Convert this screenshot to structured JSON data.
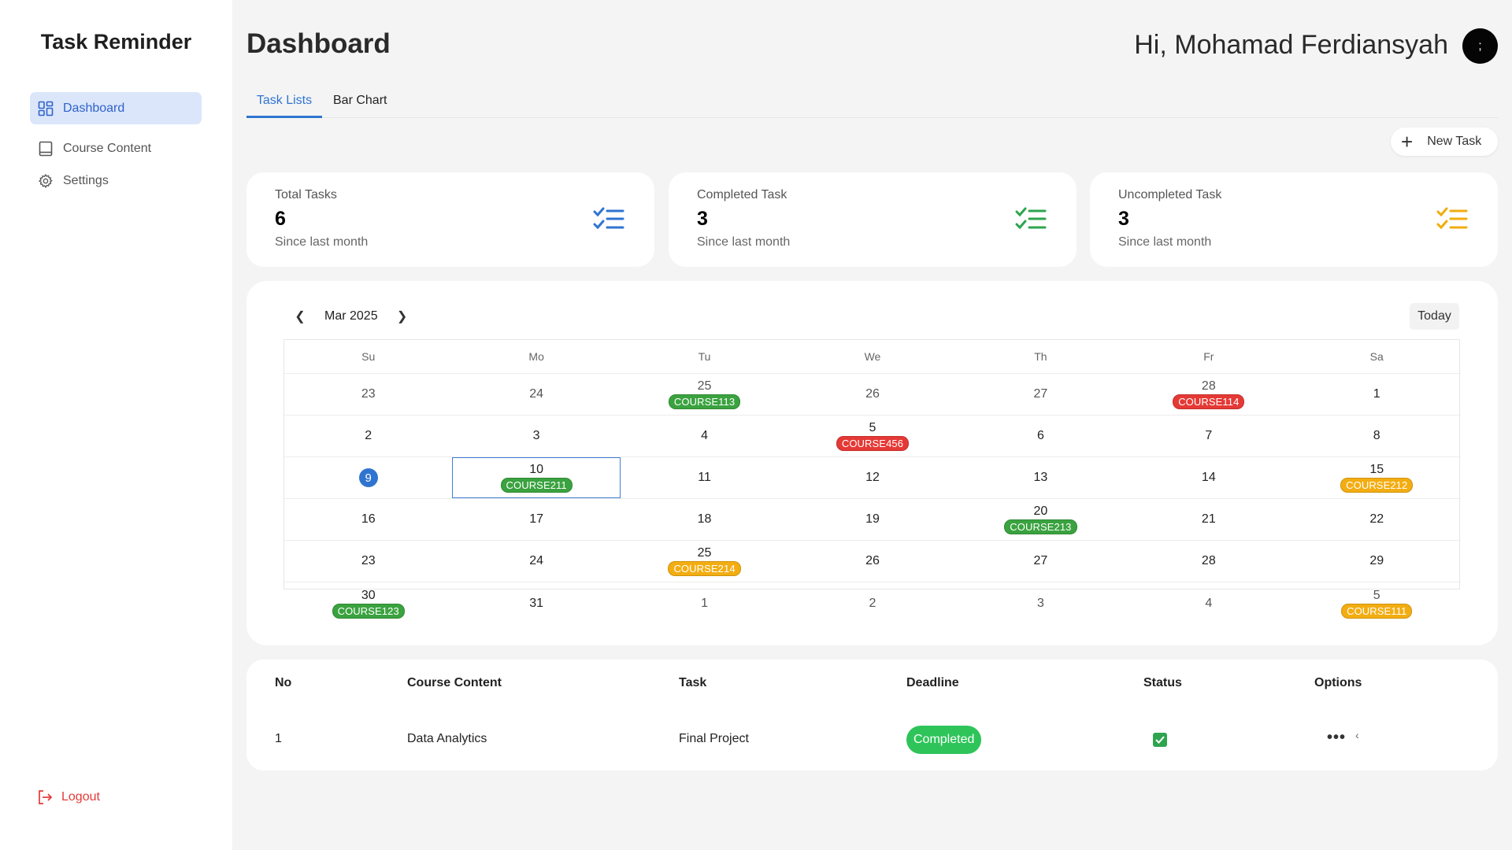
{
  "app": {
    "title": "Task Reminder"
  },
  "sidebar": {
    "items": [
      {
        "label": "Dashboard",
        "icon": "dashboard-icon"
      },
      {
        "label": "Course Content",
        "icon": "book-icon"
      },
      {
        "label": "Settings",
        "icon": "gear-icon"
      }
    ],
    "logout_label": "Logout"
  },
  "header": {
    "title": "Dashboard",
    "greeting": "Hi, Mohamad Ferdiansyah",
    "avatar_text": ";"
  },
  "tabs": [
    {
      "label": "Task Lists"
    },
    {
      "label": "Bar Chart"
    }
  ],
  "toolbar": {
    "new_task_label": "New Task"
  },
  "stats": [
    {
      "label": "Total Tasks",
      "value": "6",
      "sub": "Since last month",
      "color": "#2f74d0"
    },
    {
      "label": "Completed Task",
      "value": "3",
      "sub": "Since last month",
      "color": "#2ea44f"
    },
    {
      "label": "Uncompleted Task",
      "value": "3",
      "sub": "Since last month",
      "color": "#f0ad0e"
    }
  ],
  "calendar": {
    "month_label": "Mar 2025",
    "today_label": "Today",
    "weekdays": [
      "Su",
      "Mo",
      "Tu",
      "We",
      "Th",
      "Fr",
      "Sa"
    ],
    "badge_colors": {
      "green": "#3aa23f",
      "red": "#e53935",
      "yellow": "#f3ad12"
    },
    "weeks": [
      [
        {
          "d": "23",
          "o": true
        },
        {
          "d": "24",
          "o": true
        },
        {
          "d": "25",
          "o": true,
          "b": "COURSE113",
          "c": "green"
        },
        {
          "d": "26",
          "o": true
        },
        {
          "d": "27",
          "o": true
        },
        {
          "d": "28",
          "o": true,
          "b": "COURSE114",
          "c": "red"
        },
        {
          "d": "1"
        }
      ],
      [
        {
          "d": "2"
        },
        {
          "d": "3"
        },
        {
          "d": "4"
        },
        {
          "d": "5",
          "b": "COURSE456",
          "c": "red"
        },
        {
          "d": "6"
        },
        {
          "d": "7"
        },
        {
          "d": "8"
        }
      ],
      [
        {
          "d": "9",
          "today": true
        },
        {
          "d": "10",
          "b": "COURSE211",
          "c": "green",
          "sel": true
        },
        {
          "d": "11"
        },
        {
          "d": "12"
        },
        {
          "d": "13"
        },
        {
          "d": "14"
        },
        {
          "d": "15",
          "b": "COURSE212",
          "c": "yellow"
        }
      ],
      [
        {
          "d": "16"
        },
        {
          "d": "17"
        },
        {
          "d": "18"
        },
        {
          "d": "19"
        },
        {
          "d": "20",
          "b": "COURSE213",
          "c": "green"
        },
        {
          "d": "21"
        },
        {
          "d": "22"
        }
      ],
      [
        {
          "d": "23"
        },
        {
          "d": "24"
        },
        {
          "d": "25",
          "b": "COURSE214",
          "c": "yellow"
        },
        {
          "d": "26"
        },
        {
          "d": "27"
        },
        {
          "d": "28"
        },
        {
          "d": "29"
        }
      ],
      [
        {
          "d": "30",
          "b": "COURSE123",
          "c": "green"
        },
        {
          "d": "31"
        },
        {
          "d": "1",
          "o": true
        },
        {
          "d": "2",
          "o": true
        },
        {
          "d": "3",
          "o": true
        },
        {
          "d": "4",
          "o": true
        },
        {
          "d": "5",
          "o": true,
          "b": "COURSE111",
          "c": "yellow"
        }
      ]
    ]
  },
  "table": {
    "headers": {
      "no": "No",
      "course": "Course Content",
      "task": "Task",
      "deadline": "Deadline",
      "status": "Status",
      "options": "Options"
    },
    "rows": [
      {
        "no": "1",
        "course": "Data Analytics",
        "task": "Final Project",
        "deadline": "Completed",
        "status_checked": true,
        "options": "•••",
        "expand": "‹"
      }
    ]
  }
}
